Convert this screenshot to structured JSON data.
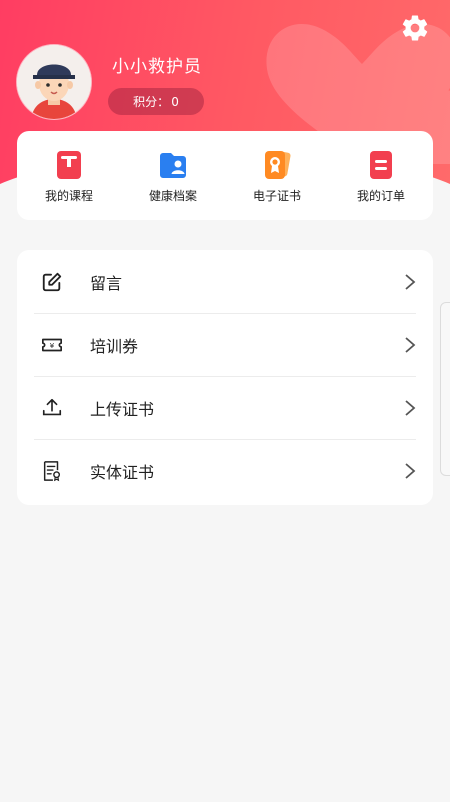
{
  "profile": {
    "username": "小小救护员",
    "points_label": "积分：",
    "points_value": "0"
  },
  "quick_actions": [
    {
      "label": "我的课程",
      "icon": "book-icon",
      "color": "#f23f4f"
    },
    {
      "label": "健康档案",
      "icon": "health-folder-icon",
      "color": "#2a7ff0"
    },
    {
      "label": "电子证书",
      "icon": "certificate-icon",
      "color": "#ff8a22"
    },
    {
      "label": "我的订单",
      "icon": "order-icon",
      "color": "#f23f4f"
    }
  ],
  "menu": [
    {
      "label": "留言",
      "icon": "edit-icon"
    },
    {
      "label": "培训券",
      "icon": "ticket-icon"
    },
    {
      "label": "上传证书",
      "icon": "upload-icon"
    },
    {
      "label": "实体证书",
      "icon": "document-certificate-icon"
    }
  ],
  "colors": {
    "header_start": "#ff3d62",
    "header_end": "#ff6a6a",
    "background": "#f6f6f6"
  }
}
